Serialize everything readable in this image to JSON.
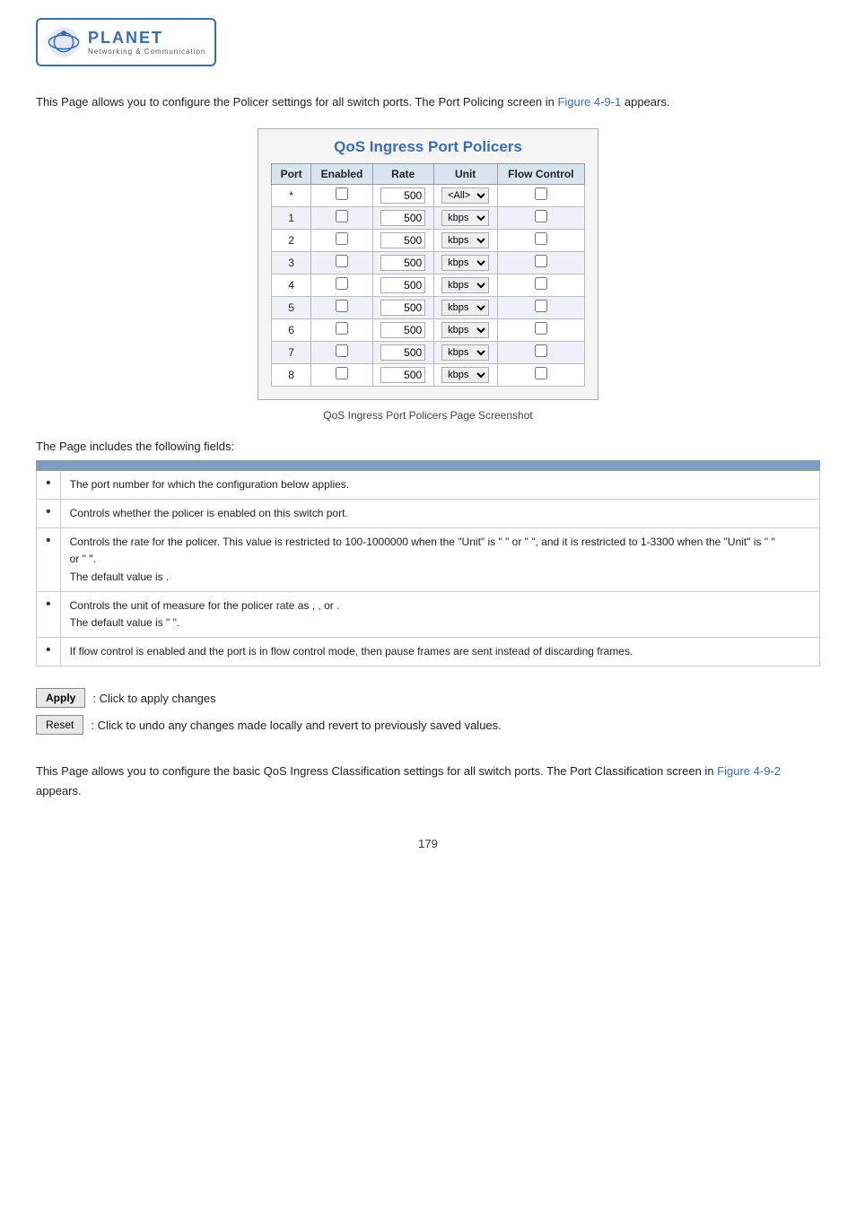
{
  "logo": {
    "planet_text": "PLANET",
    "sub_text": "Networking & Communication"
  },
  "intro": {
    "text": "This Page allows you to configure the Policer settings for all switch ports. The Port Policing screen in ",
    "link_text": "Figure 4-9-1",
    "text_after": " appears."
  },
  "table": {
    "title": "QoS Ingress Port Policers",
    "columns": [
      "Port",
      "Enabled",
      "Rate",
      "Unit",
      "Flow Control"
    ],
    "rows": [
      {
        "port": "*",
        "rate": "500",
        "unit": "<All>",
        "star": true
      },
      {
        "port": "1",
        "rate": "500",
        "unit": "kbps"
      },
      {
        "port": "2",
        "rate": "500",
        "unit": "kbps"
      },
      {
        "port": "3",
        "rate": "500",
        "unit": "kbps"
      },
      {
        "port": "4",
        "rate": "500",
        "unit": "kbps"
      },
      {
        "port": "5",
        "rate": "500",
        "unit": "kbps"
      },
      {
        "port": "6",
        "rate": "500",
        "unit": "kbps"
      },
      {
        "port": "7",
        "rate": "500",
        "unit": "kbps"
      },
      {
        "port": "8",
        "rate": "500",
        "unit": "kbps"
      }
    ],
    "caption": "QoS Ingress Port Policers Page Screenshot"
  },
  "fields_intro": "The Page includes the following fields:",
  "fields": [
    {
      "desc": "The port number for which the configuration below applies."
    },
    {
      "desc": "Controls whether the policer is enabled on this switch port."
    },
    {
      "desc": "Controls the rate for the policer. This value is restricted to 100-1000000 when the \"Unit\" is \"     \" or \"     \", and it is restricted to 1-3300 when the \"Unit\" is \"     \"\nor \"     \".\nThe default value is      ."
    },
    {
      "desc": "Controls the unit of measure for the policer rate as      ,      ,      or      .\nThe default value is \"      \"."
    },
    {
      "desc": "If flow control is enabled and the port is in flow control mode, then pause frames are sent instead of discarding frames."
    }
  ],
  "buttons": {
    "apply_label": "Apply",
    "apply_desc": ": Click to apply changes",
    "reset_label": "Reset",
    "reset_desc": ": Click to undo any changes made locally and revert to previously saved values."
  },
  "bottom": {
    "text": "This Page allows you to configure the basic QoS Ingress Classification settings for all switch ports. The Port Classification\nscreen in ",
    "link_text": "Figure 4-9-2",
    "text_after": " appears."
  },
  "page_number": "179"
}
